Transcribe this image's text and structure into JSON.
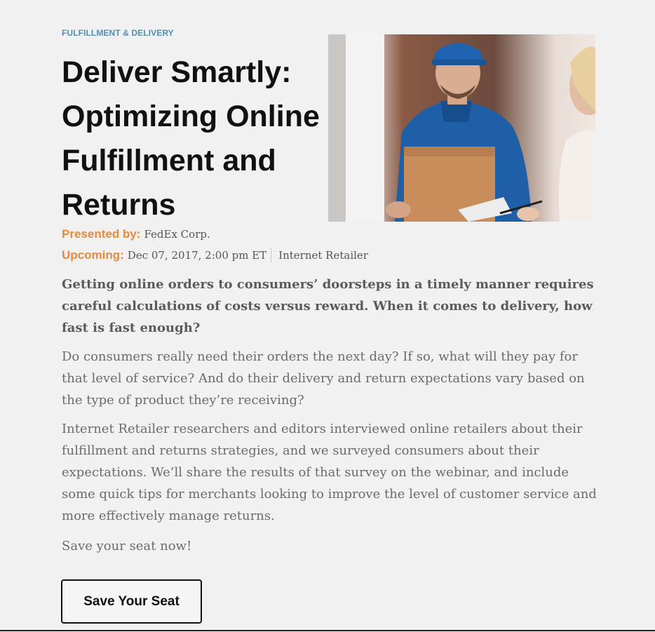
{
  "article": {
    "category": "FULFILLMENT & DELIVERY",
    "title": "Deliver Smartly: Optimizing Online Fulfillment and Returns",
    "presenter_label": "Presented by:",
    "presenter": "FedEx Corp.",
    "upcoming_label": "Upcoming:",
    "date": "Dec 07, 2017, 2:00 pm ET",
    "publisher": "Internet Retailer",
    "lede": "Getting online orders to consumers’ doorsteps in a timely manner requires careful calculations of costs versus reward. When it comes to delivery, how fast is fast enough?",
    "paragraphs": [
      "Do consumers really need their orders the next day? If so, what will they pay for that level of service? And do their delivery and return expectations vary based on the type of product they’re receiving?",
      "Internet Retailer researchers and editors interviewed online retailers about their fulfillment and returns strategies, and we surveyed consumers about their expectations. We’ll share the results of that survey on the webinar, and include some quick tips for merchants looking to improve the level of customer service and more effectively manage returns.",
      "Save your seat now!"
    ],
    "cta_label": "Save Your Seat"
  },
  "colors": {
    "category": "#4f8fbf",
    "label_orange": "#e8893b",
    "background": "#f1f1f1"
  }
}
